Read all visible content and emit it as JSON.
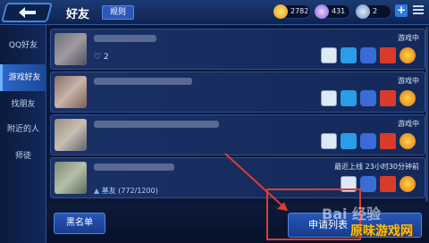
{
  "header": {
    "title": "好友",
    "rule_label": "规则",
    "currencies": [
      {
        "icon": "gold-coin-icon",
        "value": "2782",
        "color": "#f2b51b"
      },
      {
        "icon": "diamond-icon",
        "value": "431",
        "color": "#c79bff"
      },
      {
        "icon": "voucher-icon",
        "value": "2",
        "color": "#7fa8d8"
      }
    ]
  },
  "sidebar": {
    "items": [
      {
        "label": "QQ好友",
        "active": false
      },
      {
        "label": "游戏好友",
        "active": true
      },
      {
        "label": "找朋友",
        "active": false
      },
      {
        "label": "附近的人",
        "active": false
      },
      {
        "label": "师徒",
        "active": false
      }
    ]
  },
  "friends": [
    {
      "status": "游戏中",
      "likes": "2"
    },
    {
      "status": "游戏中"
    },
    {
      "status": "游戏中"
    },
    {
      "status": "最近上线  23小时30分钟前",
      "tag": "基友",
      "progress": "(772/1200)"
    }
  ],
  "bottom": {
    "blacklist_label": "黑名单",
    "apply_label": "申请列表"
  },
  "watermark": {
    "baidu": "Bai 经验",
    "site": "原味游戏网"
  }
}
